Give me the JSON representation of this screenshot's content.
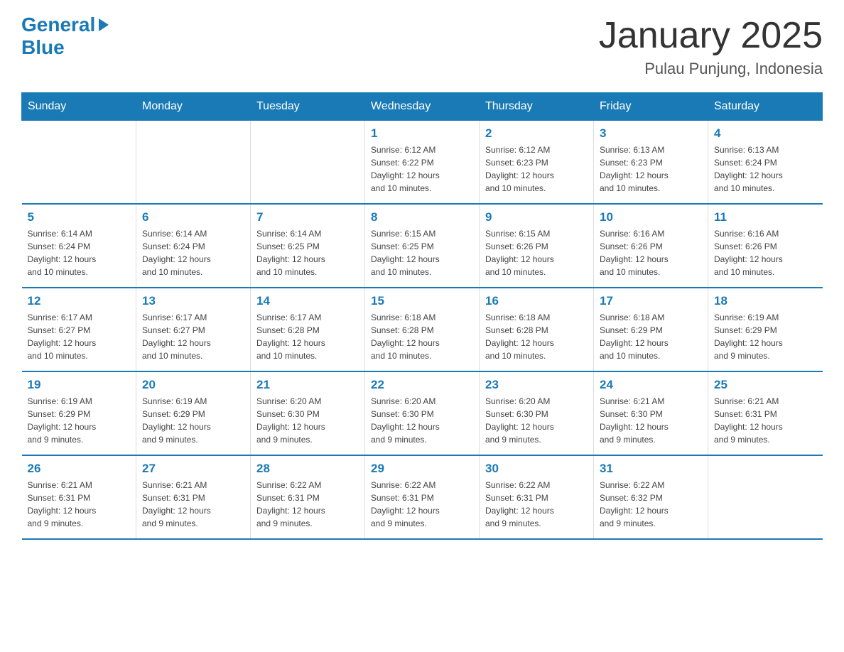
{
  "logo": {
    "general": "General",
    "blue": "Blue"
  },
  "title": "January 2025",
  "subtitle": "Pulau Punjung, Indonesia",
  "weekdays": [
    "Sunday",
    "Monday",
    "Tuesday",
    "Wednesday",
    "Thursday",
    "Friday",
    "Saturday"
  ],
  "weeks": [
    [
      null,
      null,
      null,
      {
        "day": 1,
        "sunrise": "6:12 AM",
        "sunset": "6:22 PM",
        "daylight": "12 hours and 10 minutes."
      },
      {
        "day": 2,
        "sunrise": "6:12 AM",
        "sunset": "6:23 PM",
        "daylight": "12 hours and 10 minutes."
      },
      {
        "day": 3,
        "sunrise": "6:13 AM",
        "sunset": "6:23 PM",
        "daylight": "12 hours and 10 minutes."
      },
      {
        "day": 4,
        "sunrise": "6:13 AM",
        "sunset": "6:24 PM",
        "daylight": "12 hours and 10 minutes."
      }
    ],
    [
      {
        "day": 5,
        "sunrise": "6:14 AM",
        "sunset": "6:24 PM",
        "daylight": "12 hours and 10 minutes."
      },
      {
        "day": 6,
        "sunrise": "6:14 AM",
        "sunset": "6:24 PM",
        "daylight": "12 hours and 10 minutes."
      },
      {
        "day": 7,
        "sunrise": "6:14 AM",
        "sunset": "6:25 PM",
        "daylight": "12 hours and 10 minutes."
      },
      {
        "day": 8,
        "sunrise": "6:15 AM",
        "sunset": "6:25 PM",
        "daylight": "12 hours and 10 minutes."
      },
      {
        "day": 9,
        "sunrise": "6:15 AM",
        "sunset": "6:26 PM",
        "daylight": "12 hours and 10 minutes."
      },
      {
        "day": 10,
        "sunrise": "6:16 AM",
        "sunset": "6:26 PM",
        "daylight": "12 hours and 10 minutes."
      },
      {
        "day": 11,
        "sunrise": "6:16 AM",
        "sunset": "6:26 PM",
        "daylight": "12 hours and 10 minutes."
      }
    ],
    [
      {
        "day": 12,
        "sunrise": "6:17 AM",
        "sunset": "6:27 PM",
        "daylight": "12 hours and 10 minutes."
      },
      {
        "day": 13,
        "sunrise": "6:17 AM",
        "sunset": "6:27 PM",
        "daylight": "12 hours and 10 minutes."
      },
      {
        "day": 14,
        "sunrise": "6:17 AM",
        "sunset": "6:28 PM",
        "daylight": "12 hours and 10 minutes."
      },
      {
        "day": 15,
        "sunrise": "6:18 AM",
        "sunset": "6:28 PM",
        "daylight": "12 hours and 10 minutes."
      },
      {
        "day": 16,
        "sunrise": "6:18 AM",
        "sunset": "6:28 PM",
        "daylight": "12 hours and 10 minutes."
      },
      {
        "day": 17,
        "sunrise": "6:18 AM",
        "sunset": "6:29 PM",
        "daylight": "12 hours and 10 minutes."
      },
      {
        "day": 18,
        "sunrise": "6:19 AM",
        "sunset": "6:29 PM",
        "daylight": "12 hours and 9 minutes."
      }
    ],
    [
      {
        "day": 19,
        "sunrise": "6:19 AM",
        "sunset": "6:29 PM",
        "daylight": "12 hours and 9 minutes."
      },
      {
        "day": 20,
        "sunrise": "6:19 AM",
        "sunset": "6:29 PM",
        "daylight": "12 hours and 9 minutes."
      },
      {
        "day": 21,
        "sunrise": "6:20 AM",
        "sunset": "6:30 PM",
        "daylight": "12 hours and 9 minutes."
      },
      {
        "day": 22,
        "sunrise": "6:20 AM",
        "sunset": "6:30 PM",
        "daylight": "12 hours and 9 minutes."
      },
      {
        "day": 23,
        "sunrise": "6:20 AM",
        "sunset": "6:30 PM",
        "daylight": "12 hours and 9 minutes."
      },
      {
        "day": 24,
        "sunrise": "6:21 AM",
        "sunset": "6:30 PM",
        "daylight": "12 hours and 9 minutes."
      },
      {
        "day": 25,
        "sunrise": "6:21 AM",
        "sunset": "6:31 PM",
        "daylight": "12 hours and 9 minutes."
      }
    ],
    [
      {
        "day": 26,
        "sunrise": "6:21 AM",
        "sunset": "6:31 PM",
        "daylight": "12 hours and 9 minutes."
      },
      {
        "day": 27,
        "sunrise": "6:21 AM",
        "sunset": "6:31 PM",
        "daylight": "12 hours and 9 minutes."
      },
      {
        "day": 28,
        "sunrise": "6:22 AM",
        "sunset": "6:31 PM",
        "daylight": "12 hours and 9 minutes."
      },
      {
        "day": 29,
        "sunrise": "6:22 AM",
        "sunset": "6:31 PM",
        "daylight": "12 hours and 9 minutes."
      },
      {
        "day": 30,
        "sunrise": "6:22 AM",
        "sunset": "6:31 PM",
        "daylight": "12 hours and 9 minutes."
      },
      {
        "day": 31,
        "sunrise": "6:22 AM",
        "sunset": "6:32 PM",
        "daylight": "12 hours and 9 minutes."
      },
      null
    ]
  ],
  "labels": {
    "sunrise": "Sunrise:",
    "sunset": "Sunset:",
    "daylight": "Daylight:"
  }
}
